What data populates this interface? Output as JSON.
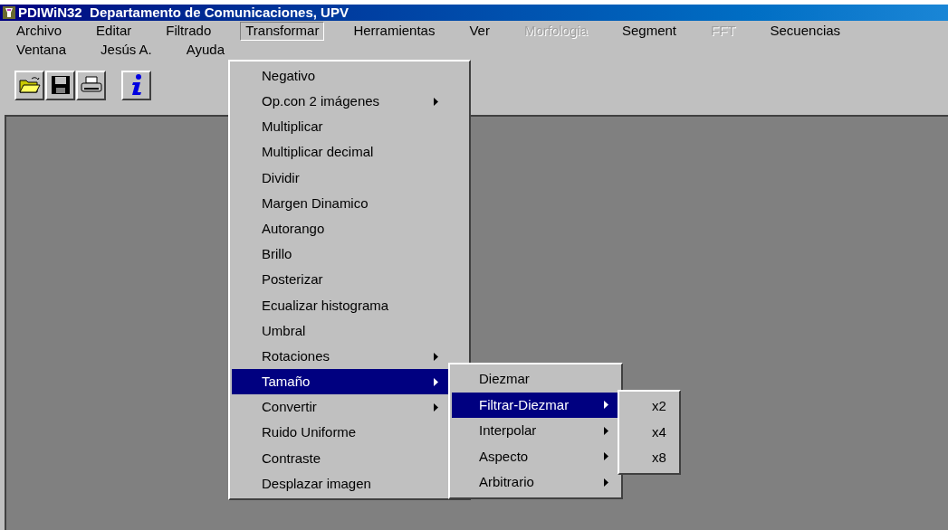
{
  "window": {
    "title": "PDIWiN32  Departamento de Comunicaciones, UPV"
  },
  "menubar": [
    {
      "label": "Archivo",
      "selected": false,
      "disabled": false
    },
    {
      "label": "Editar",
      "selected": false,
      "disabled": false
    },
    {
      "label": "Filtrado",
      "selected": false,
      "disabled": false
    },
    {
      "label": "Transformar",
      "selected": true,
      "disabled": false
    },
    {
      "label": "Herramientas",
      "selected": false,
      "disabled": false
    },
    {
      "label": "Ver",
      "selected": false,
      "disabled": false
    },
    {
      "label": "Morfologia",
      "selected": false,
      "disabled": true
    },
    {
      "label": "Segment",
      "selected": false,
      "disabled": false
    },
    {
      "label": "FFT",
      "selected": false,
      "disabled": true
    },
    {
      "label": "Secuencias",
      "selected": false,
      "disabled": false
    },
    {
      "label": "Ventana",
      "selected": false,
      "disabled": false
    },
    {
      "label": "Jesús A.",
      "selected": false,
      "disabled": false
    },
    {
      "label": "Ayuda",
      "selected": false,
      "disabled": false
    }
  ],
  "toolbar": [
    {
      "kind": "open"
    },
    {
      "kind": "save"
    },
    {
      "kind": "print"
    },
    {
      "kind": "info"
    }
  ],
  "menus": [
    {
      "items": [
        {
          "label": "Negativo",
          "submenu": false,
          "selected": false
        },
        {
          "label": "Op.con 2 imágenes",
          "submenu": true,
          "selected": false
        },
        {
          "label": "Multiplicar",
          "submenu": false,
          "selected": false
        },
        {
          "label": "Multiplicar decimal",
          "submenu": false,
          "selected": false
        },
        {
          "label": "Dividir",
          "submenu": false,
          "selected": false
        },
        {
          "label": "Margen Dinamico",
          "submenu": false,
          "selected": false
        },
        {
          "label": "Autorango",
          "submenu": false,
          "selected": false
        },
        {
          "label": "Brillo",
          "submenu": false,
          "selected": false
        },
        {
          "label": "Posterizar",
          "submenu": false,
          "selected": false
        },
        {
          "label": "Ecualizar histograma",
          "submenu": false,
          "selected": false
        },
        {
          "label": "Umbral",
          "submenu": false,
          "selected": false
        },
        {
          "label": "Rotaciones",
          "submenu": true,
          "selected": false
        },
        {
          "label": "Tamaño",
          "submenu": true,
          "selected": true
        },
        {
          "label": "Convertir",
          "submenu": true,
          "selected": false
        },
        {
          "label": "Ruido Uniforme",
          "submenu": false,
          "selected": false
        },
        {
          "label": "Contraste",
          "submenu": false,
          "selected": false
        },
        {
          "label": "Desplazar imagen",
          "submenu": false,
          "selected": false
        }
      ]
    },
    {
      "items": [
        {
          "label": "Diezmar",
          "submenu": false,
          "selected": false
        },
        {
          "label": "Filtrar-Diezmar",
          "submenu": true,
          "selected": true
        },
        {
          "label": "Interpolar",
          "submenu": true,
          "selected": false
        },
        {
          "label": "Aspecto",
          "submenu": true,
          "selected": false
        },
        {
          "label": "Arbitrario",
          "submenu": true,
          "selected": false
        }
      ]
    },
    {
      "items": [
        {
          "label": "x2",
          "submenu": false,
          "selected": false
        },
        {
          "label": "x4",
          "submenu": false,
          "selected": false
        },
        {
          "label": "x8",
          "submenu": false,
          "selected": false
        }
      ]
    }
  ]
}
